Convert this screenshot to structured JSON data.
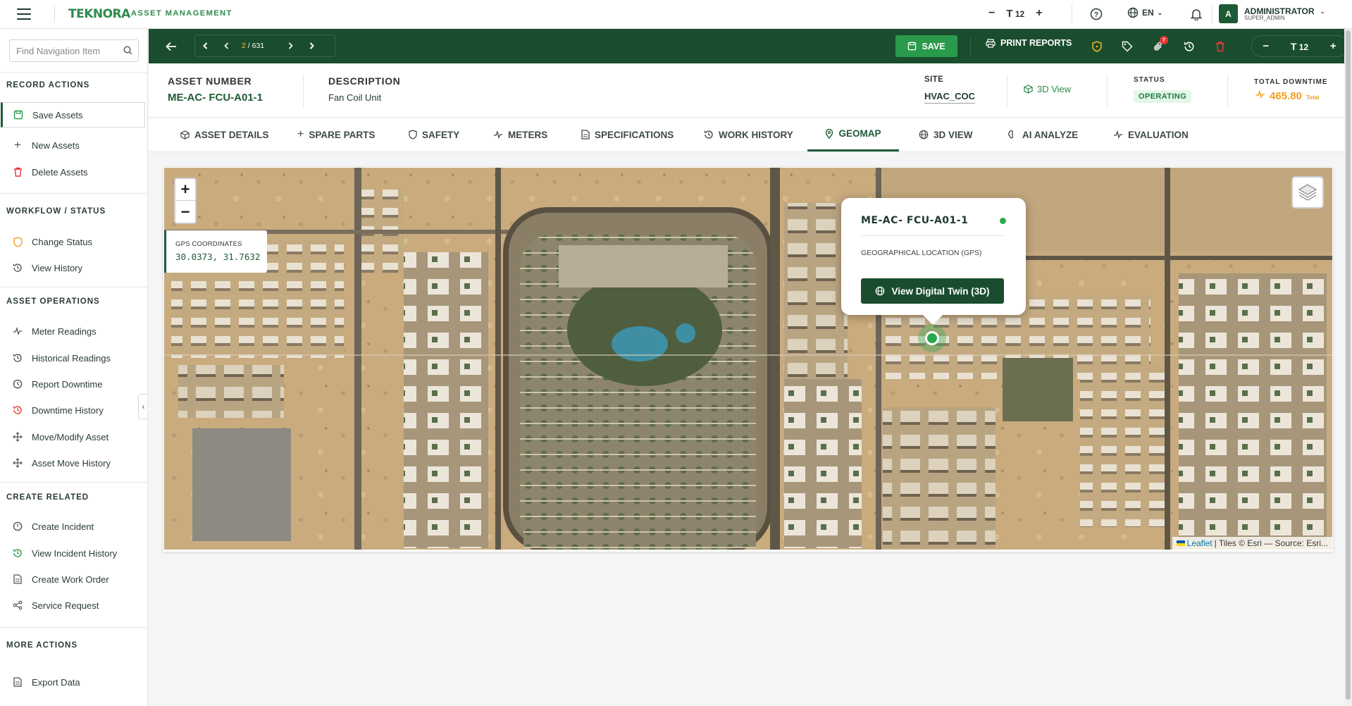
{
  "topbar": {
    "brand": "TEKNORA",
    "brand_sub": "ASSET MANAGEMENT",
    "font_size_value": "12",
    "language": "EN",
    "user_initial": "A",
    "user_name": "ADMINISTRATOR",
    "user_role": "SUPER_ADMIN"
  },
  "sidebar": {
    "search_placeholder": "Find Navigation Item",
    "sections": {
      "record_actions": "RECORD ACTIONS",
      "workflow": "WORKFLOW / STATUS",
      "asset_ops": "ASSET OPERATIONS",
      "create_related": "CREATE RELATED",
      "more_actions": "MORE ACTIONS"
    },
    "items": {
      "save_assets": "Save Assets",
      "new_assets": "New Assets",
      "delete_assets": "Delete Assets",
      "change_status": "Change Status",
      "view_history": "View History",
      "meter_readings": "Meter Readings",
      "historical_readings": "Historical Readings",
      "report_downtime": "Report Downtime",
      "downtime_history": "Downtime History",
      "move_modify": "Move/Modify Asset",
      "asset_move_history": "Asset Move History",
      "create_incident": "Create Incident",
      "view_incident_history": "View Incident History",
      "create_work_order": "Create Work Order",
      "service_request": "Service Request",
      "export_data": "Export Data"
    }
  },
  "toolbar": {
    "page_current": "2",
    "page_total": "/ 631",
    "save_label": "SAVE",
    "print_label": "PRINT REPORTS",
    "badge_count": "7",
    "font_size_value": "12"
  },
  "header": {
    "asset_number_label": "ASSET NUMBER",
    "asset_number": "ME-AC- FCU-A01-1",
    "description_label": "DESCRIPTION",
    "description": "Fan Coil Unit",
    "site_label": "SITE",
    "site": "HVAC_COC",
    "view_3d": "3D View",
    "status_label": "STATUS",
    "status": "OPERATING",
    "downtime_label": "TOTAL DOWNTIME",
    "downtime_value": "465.80",
    "downtime_unit": "Total"
  },
  "tabs": {
    "asset_details": "ASSET DETAILS",
    "spare_parts": "SPARE PARTS",
    "safety": "SAFETY",
    "meters": "METERS",
    "specifications": "SPECIFICATIONS",
    "work_history": "WORK HISTORY",
    "geomap": "GEOMAP",
    "view_3d": "3D VIEW",
    "ai_analyze": "AI ANALYZE",
    "evaluation": "EVALUATION",
    "active": "geomap"
  },
  "map": {
    "gps_label": "GPS COORDINATES",
    "gps_value": "30.0373, 31.7632",
    "popup_title": "ME-AC- FCU-A01-1",
    "popup_subtitle": "GEOGRAPHICAL LOCATION (GPS)",
    "popup_button": "View Digital Twin (3D)",
    "attribution_leaflet": "Leaflet",
    "attribution_tiles": "| Tiles © Esri — Source: Esri..."
  },
  "colors": {
    "brand_green": "#1a4d2e",
    "accent_green": "#2a9b4c",
    "downtime_orange": "#f0a020",
    "danger_red": "#e53935"
  }
}
